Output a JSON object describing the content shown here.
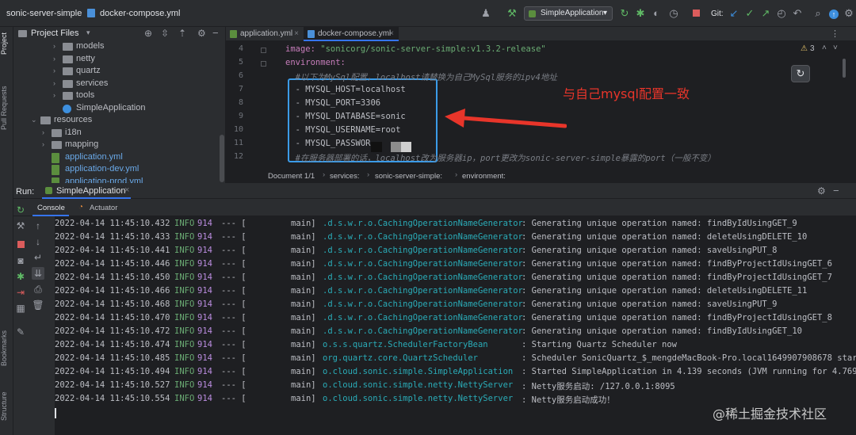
{
  "topbar": {
    "project_name": "sonic-server-simple",
    "open_file": "docker-compose.yml",
    "run_config": "SimpleApplication",
    "git_label": "Git:"
  },
  "left_stripe": {
    "project": "Project",
    "pull_requests": "Pull Requests",
    "bookmarks": "Bookmarks",
    "structure": "Structure"
  },
  "project_panel": {
    "title": "Project Files",
    "items": [
      {
        "label": "models",
        "kind": "folder",
        "depth": 4,
        "arrow": "›"
      },
      {
        "label": "netty",
        "kind": "folder",
        "depth": 4,
        "arrow": "›"
      },
      {
        "label": "quartz",
        "kind": "folder",
        "depth": 4,
        "arrow": "›"
      },
      {
        "label": "services",
        "kind": "folder",
        "depth": 4,
        "arrow": "›"
      },
      {
        "label": "tools",
        "kind": "folder",
        "depth": 4,
        "arrow": "›"
      },
      {
        "label": "SimpleApplication",
        "kind": "class",
        "depth": 4,
        "arrow": ""
      },
      {
        "label": "resources",
        "kind": "folder",
        "depth": 2,
        "arrow": "⌄"
      },
      {
        "label": "i18n",
        "kind": "folder",
        "depth": 3,
        "arrow": "›"
      },
      {
        "label": "mapping",
        "kind": "folder",
        "depth": 3,
        "arrow": "›"
      },
      {
        "label": "application.yml",
        "kind": "yml",
        "depth": 3,
        "arrow": ""
      },
      {
        "label": "application-dev.yml",
        "kind": "yml",
        "depth": 3,
        "arrow": ""
      },
      {
        "label": "application-prod.yml",
        "kind": "yml",
        "depth": 3,
        "arrow": ""
      }
    ]
  },
  "editor": {
    "tabs": [
      {
        "label": "application.yml",
        "active": false
      },
      {
        "label": "docker-compose.yml",
        "active": true
      }
    ],
    "lines": [
      {
        "num": "4",
        "indent": "",
        "key": "image: ",
        "value": "\"sonicorg/sonic-server-simple:v1.3.2-release\"",
        "kind": "kv"
      },
      {
        "num": "5",
        "indent": "",
        "key": "environment:",
        "value": "",
        "kind": "kv"
      },
      {
        "num": "6",
        "indent": "  ",
        "key": "",
        "value": "#以下为MySql配置，localhost请替换为自己MySql服务的ipv4地址",
        "kind": "comment"
      },
      {
        "num": "7",
        "indent": "  ",
        "key": "",
        "value": "- MYSQL_HOST=localhost",
        "kind": "plain"
      },
      {
        "num": "8",
        "indent": "  ",
        "key": "",
        "value": "- MYSQL_PORT=3306",
        "kind": "plain"
      },
      {
        "num": "9",
        "indent": "  ",
        "key": "",
        "value": "- MYSQL_DATABASE=sonic",
        "kind": "plain"
      },
      {
        "num": "10",
        "indent": "  ",
        "key": "",
        "value": "- MYSQL_USERNAME=root",
        "kind": "plain"
      },
      {
        "num": "11",
        "indent": "  ",
        "key": "",
        "value": "- MYSQL_PASSWOR",
        "kind": "plain"
      },
      {
        "num": "12",
        "indent": "  ",
        "key": "",
        "value": "#在服务器部署的话，localhost改为服务器ip，port更改为sonic-server-simple暴露的port（一般不变）",
        "kind": "comment"
      }
    ],
    "inspection_count": "3",
    "annotation": "与自己mysql配置一致",
    "breadcrumb": [
      "Document 1/1",
      "services:",
      "sonic-server-simple:",
      "environment:"
    ]
  },
  "run_panel": {
    "run_label": "Run:",
    "run_config": "SimpleApplication",
    "tabs": [
      "Console",
      "Actuator"
    ],
    "logs": [
      {
        "ts": "2022-04-14 11:45:10.432",
        "lvl": "INFO",
        "pid": "914",
        "dash": "--- [",
        "thr": "main]",
        "logger": ".d.s.w.r.o.CachingOperationNameGenerator",
        "msg": ": Generating unique operation named: findByIdUsingGET_9"
      },
      {
        "ts": "2022-04-14 11:45:10.433",
        "lvl": "INFO",
        "pid": "914",
        "dash": "--- [",
        "thr": "main]",
        "logger": ".d.s.w.r.o.CachingOperationNameGenerator",
        "msg": ": Generating unique operation named: deleteUsingDELETE_10"
      },
      {
        "ts": "2022-04-14 11:45:10.441",
        "lvl": "INFO",
        "pid": "914",
        "dash": "--- [",
        "thr": "main]",
        "logger": ".d.s.w.r.o.CachingOperationNameGenerator",
        "msg": ": Generating unique operation named: saveUsingPUT_8"
      },
      {
        "ts": "2022-04-14 11:45:10.446",
        "lvl": "INFO",
        "pid": "914",
        "dash": "--- [",
        "thr": "main]",
        "logger": ".d.s.w.r.o.CachingOperationNameGenerator",
        "msg": ": Generating unique operation named: findByProjectIdUsingGET_6"
      },
      {
        "ts": "2022-04-14 11:45:10.450",
        "lvl": "INFO",
        "pid": "914",
        "dash": "--- [",
        "thr": "main]",
        "logger": ".d.s.w.r.o.CachingOperationNameGenerator",
        "msg": ": Generating unique operation named: findByProjectIdUsingGET_7"
      },
      {
        "ts": "2022-04-14 11:45:10.466",
        "lvl": "INFO",
        "pid": "914",
        "dash": "--- [",
        "thr": "main]",
        "logger": ".d.s.w.r.o.CachingOperationNameGenerator",
        "msg": ": Generating unique operation named: deleteUsingDELETE_11"
      },
      {
        "ts": "2022-04-14 11:45:10.468",
        "lvl": "INFO",
        "pid": "914",
        "dash": "--- [",
        "thr": "main]",
        "logger": ".d.s.w.r.o.CachingOperationNameGenerator",
        "msg": ": Generating unique operation named: saveUsingPUT_9"
      },
      {
        "ts": "2022-04-14 11:45:10.470",
        "lvl": "INFO",
        "pid": "914",
        "dash": "--- [",
        "thr": "main]",
        "logger": ".d.s.w.r.o.CachingOperationNameGenerator",
        "msg": ": Generating unique operation named: findByProjectIdUsingGET_8"
      },
      {
        "ts": "2022-04-14 11:45:10.472",
        "lvl": "INFO",
        "pid": "914",
        "dash": "--- [",
        "thr": "main]",
        "logger": ".d.s.w.r.o.CachingOperationNameGenerator",
        "msg": ": Generating unique operation named: findByIdUsingGET_10"
      },
      {
        "ts": "2022-04-14 11:45:10.474",
        "lvl": "INFO",
        "pid": "914",
        "dash": "--- [",
        "thr": "main]",
        "logger": "o.s.s.quartz.SchedulerFactoryBean",
        "msg": ": Starting Quartz Scheduler now"
      },
      {
        "ts": "2022-04-14 11:45:10.485",
        "lvl": "INFO",
        "pid": "914",
        "dash": "--- [",
        "thr": "main]",
        "logger": "org.quartz.core.QuartzScheduler",
        "msg": ": Scheduler SonicQuartz_$_mengdeMacBook-Pro.local1649907908678 star"
      },
      {
        "ts": "2022-04-14 11:45:10.494",
        "lvl": "INFO",
        "pid": "914",
        "dash": "--- [",
        "thr": "main]",
        "logger": "o.cloud.sonic.simple.SimpleApplication",
        "msg": ": Started SimpleApplication in 4.139 seconds (JVM running for 4.769"
      },
      {
        "ts": "2022-04-14 11:45:10.527",
        "lvl": "INFO",
        "pid": "914",
        "dash": "--- [",
        "thr": "main]",
        "logger": "o.cloud.sonic.simple.netty.NettyServer",
        "msg": ": Netty服务启动: /127.0.0.1:8095"
      },
      {
        "ts": "2022-04-14 11:45:10.554",
        "lvl": "INFO",
        "pid": "914",
        "dash": "--- [",
        "thr": "main]",
        "logger": "o.cloud.sonic.simple.netty.NettyServer",
        "msg": ": Netty服务启动成功！"
      }
    ]
  },
  "watermark": "@稀土掘金技术社区",
  "colors": {
    "accent": "#3574f0",
    "annotation": "#e8352a",
    "highlight_box": "#3b9be8"
  }
}
